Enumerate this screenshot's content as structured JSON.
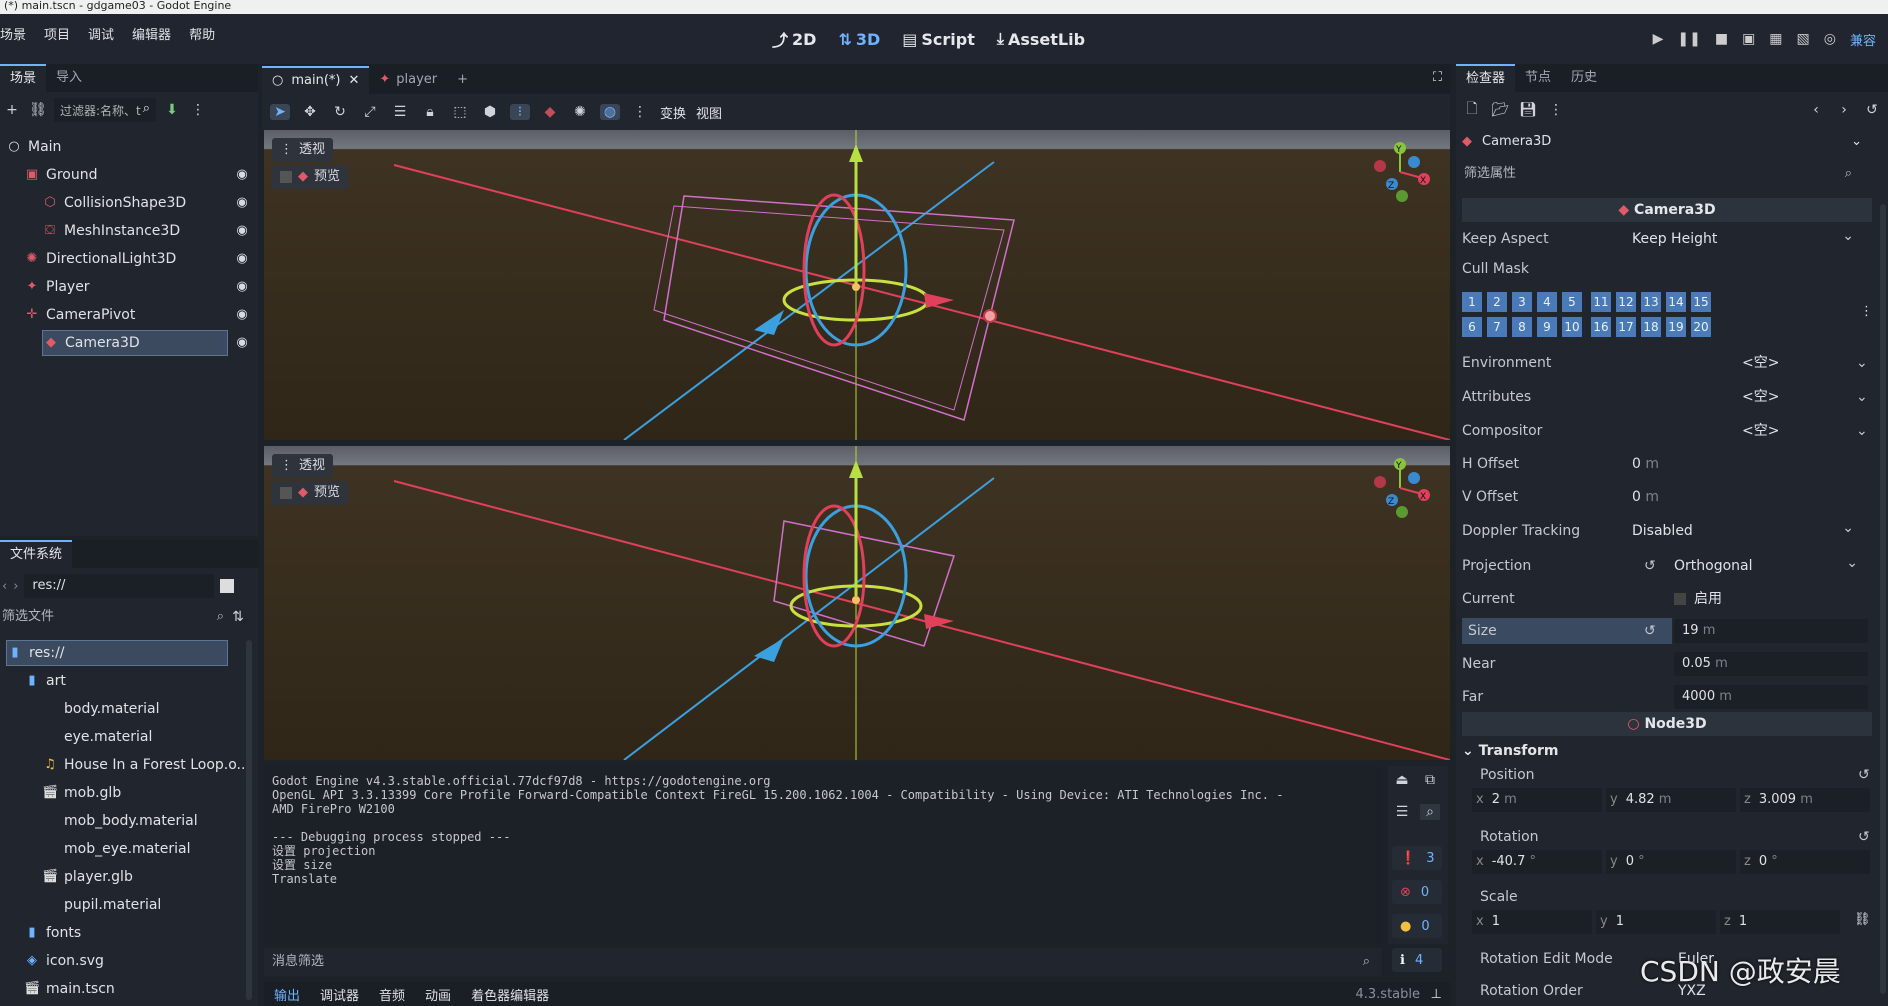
{
  "window": {
    "title": "(*) main.tscn - gdgame03 - Godot Engine"
  },
  "menu": [
    "场景",
    "项目",
    "调试",
    "编辑器",
    "帮助"
  ],
  "modes": [
    {
      "label": "2D",
      "icon": "2d-icon",
      "active": false
    },
    {
      "label": "3D",
      "icon": "3d-icon",
      "active": true
    },
    {
      "label": "Script",
      "icon": "script-icon",
      "active": false
    },
    {
      "label": "AssetLib",
      "icon": "assetlib-icon",
      "active": false
    }
  ],
  "run": {
    "mode_label": "兼容"
  },
  "scene_dock": {
    "tabs": [
      "场景",
      "导入"
    ],
    "filter_placeholder": "过滤器:名称、t",
    "nodes": [
      {
        "label": "Main",
        "icon": "node-icon",
        "depth": 0
      },
      {
        "label": "Ground",
        "icon": "static-body-icon",
        "depth": 1
      },
      {
        "label": "CollisionShape3D",
        "icon": "collision-shape-icon",
        "depth": 2
      },
      {
        "label": "MeshInstance3D",
        "icon": "mesh-icon",
        "depth": 2
      },
      {
        "label": "DirectionalLight3D",
        "icon": "light-icon",
        "depth": 1
      },
      {
        "label": "Player",
        "icon": "player-icon",
        "depth": 1
      },
      {
        "label": "CameraPivot",
        "icon": "marker-icon",
        "depth": 1
      },
      {
        "label": "Camera3D",
        "icon": "camera-icon",
        "depth": 2
      }
    ]
  },
  "filesystem": {
    "tab": "文件系统",
    "path": "res://",
    "filter_placeholder": "筛选文件",
    "items": [
      {
        "label": "res://",
        "depth": 0,
        "icon": "folder-icon"
      },
      {
        "label": "art",
        "depth": 1,
        "icon": "folder-icon"
      },
      {
        "label": "body.material",
        "depth": 2,
        "icon": "material-icon"
      },
      {
        "label": "eye.material",
        "depth": 2,
        "icon": "material-icon"
      },
      {
        "label": "House In a Forest Loop.o...",
        "depth": 2,
        "icon": "audio-icon"
      },
      {
        "label": "mob.glb",
        "depth": 2,
        "icon": "scene-icon"
      },
      {
        "label": "mob_body.material",
        "depth": 2,
        "icon": "material-icon"
      },
      {
        "label": "mob_eye.material",
        "depth": 2,
        "icon": "material-icon"
      },
      {
        "label": "player.glb",
        "depth": 2,
        "icon": "scene-icon"
      },
      {
        "label": "pupil.material",
        "depth": 2,
        "icon": "material-icon"
      },
      {
        "label": "fonts",
        "depth": 1,
        "icon": "folder-icon"
      },
      {
        "label": "icon.svg",
        "depth": 1,
        "icon": "image-icon"
      },
      {
        "label": "main.tscn",
        "depth": 1,
        "icon": "scene-icon"
      }
    ]
  },
  "editor_tabs": [
    "main(*)",
    "player"
  ],
  "toolbar": {
    "transform_label": "变换",
    "view_label": "视图"
  },
  "viewport": {
    "perspective_label": "透视",
    "preview_label": "预览"
  },
  "console": {
    "lines": [
      "Godot Engine v4.3.stable.official.77dcf97d8 - https://godotengine.org",
      "OpenGL API 3.3.13399 Core Profile Forward-Compatible Context FireGL 15.200.1062.1004 - Compatibility - Using Device: ATI Technologies Inc. -",
      "AMD FirePro W2100",
      "",
      "--- Debugging process stopped ---",
      "设置 projection",
      "设置 size",
      "Translate"
    ],
    "filter_placeholder": "消息筛选",
    "counts": {
      "messages": "3",
      "errors": "0",
      "warnings": "0",
      "info": "4"
    }
  },
  "bottom_tabs": [
    "输出",
    "调试器",
    "音频",
    "动画",
    "着色器编辑器"
  ],
  "version": "4.3.stable",
  "inspector": {
    "tabs": [
      "检查器",
      "节点",
      "历史"
    ],
    "object": "Camera3D",
    "filter_placeholder": "筛选属性",
    "section_camera": "Camera3D",
    "keep_aspect": {
      "label": "Keep Aspect",
      "value": "Keep Height"
    },
    "cull_mask": {
      "label": "Cull Mask",
      "row1": [
        "1",
        "2",
        "3",
        "4",
        "5",
        "11",
        "12",
        "13",
        "14",
        "15"
      ],
      "row2": [
        "6",
        "7",
        "8",
        "9",
        "10",
        "16",
        "17",
        "18",
        "19",
        "20"
      ]
    },
    "environment": {
      "label": "Environment",
      "value": "<空>"
    },
    "attributes": {
      "label": "Attributes",
      "value": "<空>"
    },
    "compositor": {
      "label": "Compositor",
      "value": "<空>"
    },
    "h_offset": {
      "label": "H Offset",
      "value": "0",
      "unit": "m"
    },
    "v_offset": {
      "label": "V Offset",
      "value": "0",
      "unit": "m"
    },
    "doppler": {
      "label": "Doppler Tracking",
      "value": "Disabled"
    },
    "projection": {
      "label": "Projection",
      "value": "Orthogonal"
    },
    "current": {
      "label": "Current",
      "value": "启用"
    },
    "size": {
      "label": "Size",
      "value": "19",
      "unit": "m"
    },
    "near": {
      "label": "Near",
      "value": "0.05",
      "unit": "m"
    },
    "far": {
      "label": "Far",
      "value": "4000",
      "unit": "m"
    },
    "section_node3d": "Node3D",
    "transform": {
      "label": "Transform",
      "position": {
        "label": "Position",
        "x": "2",
        "y": "4.82",
        "z": "3.009",
        "unit": "m"
      },
      "rotation": {
        "label": "Rotation",
        "x": "-40.7",
        "y": "0",
        "z": "0",
        "unit": "°"
      },
      "scale": {
        "label": "Scale",
        "x": "1",
        "y": "1",
        "z": "1"
      },
      "rotation_edit_mode": {
        "label": "Rotation Edit Mode",
        "value": "Euler"
      },
      "rotation_order": {
        "label": "Rotation Order",
        "value": "YXZ"
      }
    }
  },
  "watermark": "CSDN @政安晨"
}
